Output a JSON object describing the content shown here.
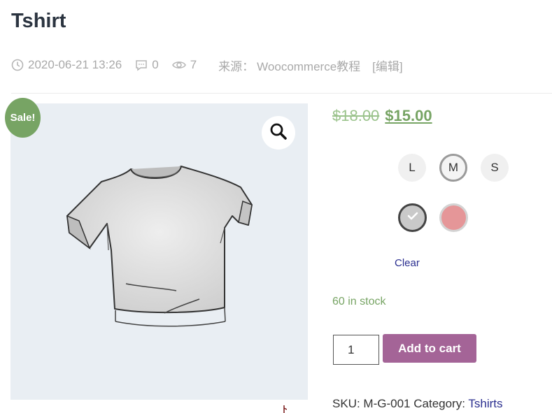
{
  "product": {
    "title": "Tshirt",
    "date": "2020-06-21 13:26",
    "comments": "0",
    "views": "7",
    "source_label": "来源：",
    "source_value": "Woocommerce教程",
    "edit": "[编辑]",
    "sale_badge": "Sale!",
    "price_old": "$18.00",
    "price_new": "$15.00",
    "stock": "60 in stock",
    "quantity": "1",
    "add_to_cart": "Add to cart",
    "sku_label": "SKU:",
    "sku_value": "M-G-001",
    "category_label": "Category:",
    "category_value": "Tshirts"
  },
  "variations": {
    "sizes": [
      {
        "label": "L",
        "selected": false
      },
      {
        "label": "M",
        "selected": true
      },
      {
        "label": "S",
        "selected": false
      }
    ],
    "colors": [
      {
        "name": "grey",
        "hex": "#c9c9c9",
        "selected": true
      },
      {
        "name": "pink",
        "hex": "#e59698",
        "selected": false
      }
    ],
    "clear": "Clear"
  },
  "icons": {
    "date": "clock-icon",
    "comments": "comment-icon",
    "views": "eye-icon",
    "zoom": "magnifier-icon"
  },
  "colors": {
    "accent_green": "#77a464",
    "button_purple": "#a46497",
    "link_blue": "#2a2e8f"
  }
}
